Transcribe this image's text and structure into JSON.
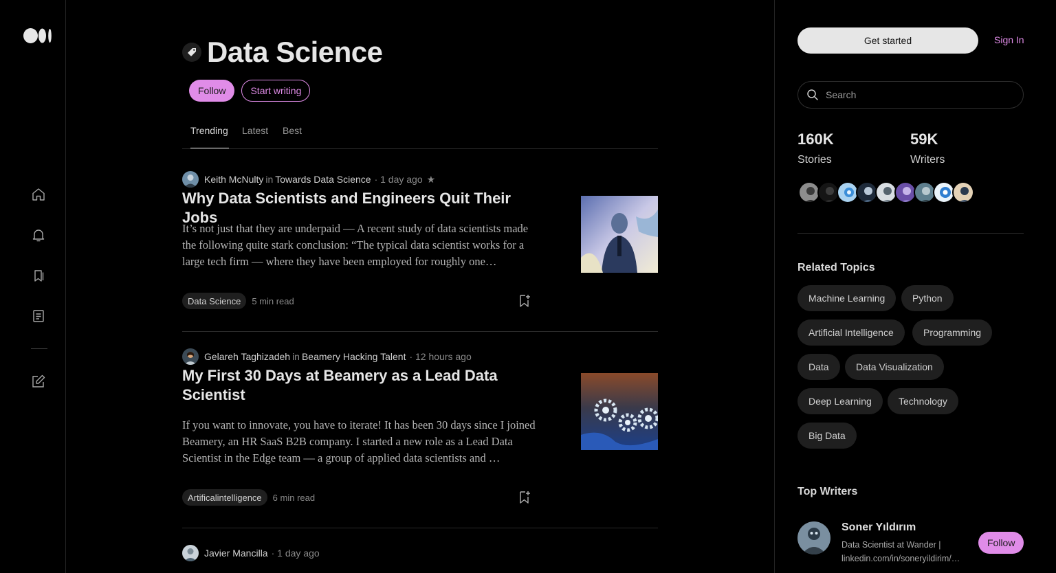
{
  "brand": {
    "logo_icon": "medium-logo-icon",
    "accent": "#e08ce8"
  },
  "nav": {
    "items": [
      {
        "name": "home",
        "icon": "home-icon"
      },
      {
        "name": "notifications",
        "icon": "bell-icon"
      },
      {
        "name": "lists",
        "icon": "bookmarks-icon"
      },
      {
        "name": "stories",
        "icon": "document-icon"
      },
      {
        "name": "write",
        "icon": "write-icon"
      }
    ]
  },
  "topic": {
    "title": "Data Science",
    "tag_icon": "tag-icon",
    "follow_label": "Follow",
    "write_label": "Start writing"
  },
  "tabs": [
    {
      "label": "Trending",
      "active": true
    },
    {
      "label": "Latest",
      "active": false
    },
    {
      "label": "Best",
      "active": false
    }
  ],
  "articles": [
    {
      "author": "Keith McNulty",
      "in_label": "in",
      "publication": "Towards Data Science",
      "time": "· 1 day ago",
      "star": "★",
      "title": "Why Data Scientists and Engineers Quit Their Jobs",
      "excerpt": "It’s not just that they are underpaid — A recent study of data scientists made the following quite stark conclusion: “The typical data scientist works for a large tech firm — where they have been employed for roughly one…",
      "tag": "Data Science",
      "read_time": "5 min read"
    },
    {
      "author": "Gelareh Taghizadeh",
      "in_label": "in",
      "publication": "Beamery Hacking Talent",
      "time": "· 12 hours ago",
      "title": "My First 30 Days at Beamery as a Lead Data Scientist",
      "excerpt": "If you want to innovate, you have to iterate! It has been 30 days since I joined Beamery, an HR SaaS B2B company. I started a new role as a Lead Data Scientist in the Edge team — a group of applied data scientists and …",
      "tag": "Artificalintelligence",
      "read_time": "6 min read"
    },
    {
      "author": "Javier Mancilla",
      "time": "· 1 day ago"
    }
  ],
  "sidebar": {
    "get_started": "Get started",
    "sign_in": "Sign In",
    "search_placeholder": "Search",
    "stats": [
      {
        "value": "160K",
        "label": "Stories"
      },
      {
        "value": "59K",
        "label": "Writers"
      }
    ],
    "related_heading": "Related Topics",
    "related_topics": [
      "Machine Learning",
      "Python",
      "Artificial Intelligence",
      "Programming",
      "Data",
      "Data Visualization",
      "Deep Learning",
      "Technology",
      "Big Data"
    ],
    "top_writers_heading": "Top Writers",
    "writer": {
      "name": "Soner Yıldırım",
      "bio": "Data Scientist at Wander | linkedin.com/in/soneryildirim/…",
      "follow_label": "Follow"
    }
  }
}
